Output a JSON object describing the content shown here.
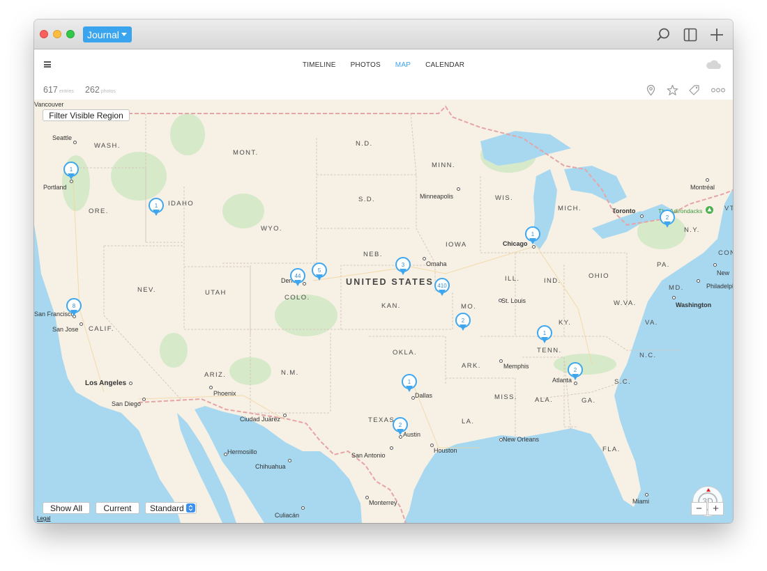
{
  "titlebar": {
    "journal_label": "Journal",
    "icons": [
      "search-icon",
      "sidebar-toggle-icon",
      "plus-icon"
    ]
  },
  "nav": {
    "tabs": [
      {
        "label": "TIMELINE",
        "active": false
      },
      {
        "label": "PHOTOS",
        "active": false
      },
      {
        "label": "MAP",
        "active": true
      },
      {
        "label": "CALENDAR",
        "active": false
      }
    ],
    "accent_color": "#3ba4ef"
  },
  "stats": {
    "entries_count": "617",
    "entries_label": "entries",
    "photos_count": "262",
    "photos_label": "photos",
    "icons": [
      "location-pin-icon",
      "star-icon",
      "tag-icon",
      "more-icon"
    ]
  },
  "map": {
    "filter_button": "Filter Visible Region",
    "show_all_button": "Show All",
    "current_button": "Current",
    "map_type_selected": "Standard",
    "legal_link": "Legal",
    "compass_label": "3D",
    "zoom_out": "−",
    "zoom_in": "+",
    "country_label": "UNITED STATES",
    "states": [
      "WASH.",
      "MONT.",
      "N.D.",
      "MINN.",
      "IDAHO",
      "ORE.",
      "WYO.",
      "S.D.",
      "WIS.",
      "MICH.",
      "N.Y.",
      "VT",
      "NEB.",
      "IOWA",
      "ILL.",
      "IND.",
      "OHIO",
      "PA.",
      "NEV.",
      "UTAH",
      "COLO.",
      "KAN.",
      "MO.",
      "KY.",
      "W.VA.",
      "VA.",
      "MD.",
      "CALIF.",
      "TENN.",
      "N.C.",
      "OKLA.",
      "ARK.",
      "ARIZ.",
      "N.M.",
      "S.C.",
      "MISS.",
      "ALA.",
      "GA.",
      "TEXAS",
      "LA.",
      "FLA.",
      "CON"
    ],
    "cities": [
      "Vancouver",
      "Seattle",
      "Portland",
      "Minneapolis",
      "Chicago",
      "Toronto",
      "Montréal",
      "Omaha",
      "Denver",
      "St. Louis",
      "New",
      "Philadelphia",
      "Washington",
      "San Francisco",
      "San Jose",
      "Memphis",
      "Atlanta",
      "Los Angeles",
      "San Diego",
      "Phoenix",
      "Dallas",
      "Ciudad Juárez",
      "Austin",
      "Hermosillo",
      "San Antonio",
      "Houston",
      "New Orleans",
      "Chihuahua",
      "Monterrey",
      "Miami",
      "Culiacán"
    ],
    "park_label": "The Adirondacks",
    "pins": [
      "1",
      "1",
      "44",
      "5",
      "3",
      "410",
      "8",
      "2",
      "1",
      "1",
      "2",
      "1",
      "2",
      "2"
    ]
  }
}
